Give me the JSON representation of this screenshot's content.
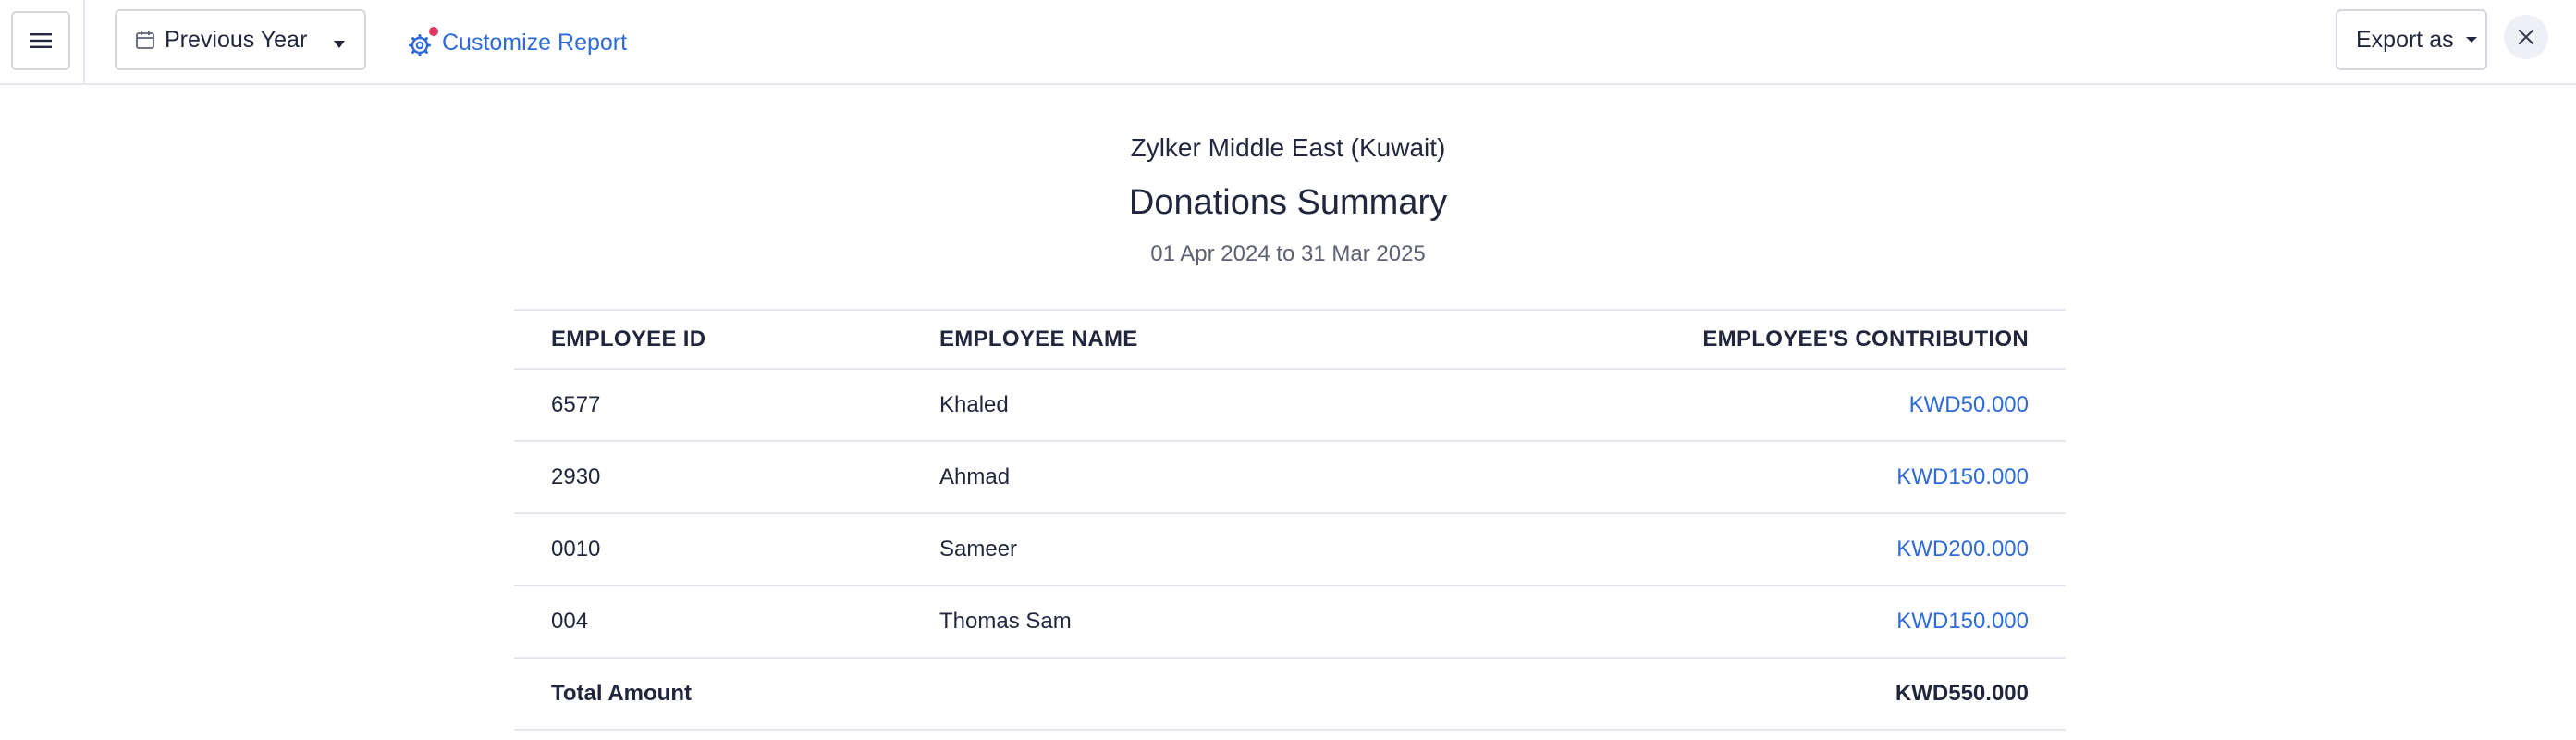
{
  "toolbar": {
    "menu_icon": "hamburger-icon",
    "period_label": "Previous Year",
    "customize_label": "Customize Report",
    "export_label": "Export as",
    "accent_color": "#2e6ad8",
    "notification_dot_color": "#e0365f"
  },
  "report": {
    "organization": "Zylker Middle East (Kuwait)",
    "title": "Donations Summary",
    "date_range": "01 Apr 2024 to 31 Mar 2025"
  },
  "table": {
    "columns": [
      "EMPLOYEE ID",
      "EMPLOYEE NAME",
      "EMPLOYEE'S CONTRIBUTION"
    ],
    "rows": [
      {
        "id": "6577",
        "name": "Khaled",
        "contribution": "KWD50.000"
      },
      {
        "id": "2930",
        "name": "Ahmad",
        "contribution": "KWD150.000"
      },
      {
        "id": "0010",
        "name": "Sameer",
        "contribution": "KWD200.000"
      },
      {
        "id": "004",
        "name": "Thomas Sam",
        "contribution": "KWD150.000"
      }
    ],
    "total_label": "Total Amount",
    "total_value": "KWD550.000"
  }
}
